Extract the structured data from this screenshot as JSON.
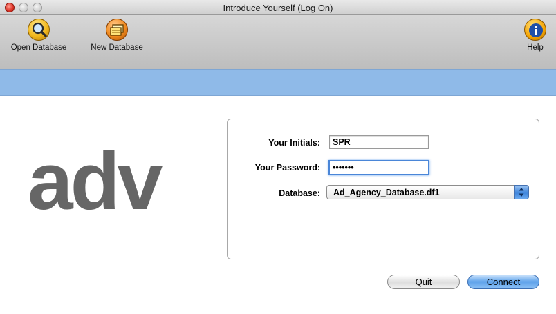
{
  "window": {
    "title": "Introduce Yourself (Log On)"
  },
  "toolbar": {
    "open_label": "Open Database",
    "new_label": "New Database",
    "help_label": "Help",
    "open_icon": "magnifier-icon",
    "new_icon": "new-database-icon",
    "help_icon": "info-icon"
  },
  "logo": {
    "text": "adv"
  },
  "form": {
    "initials_label": "Your Initials:",
    "initials_value": "SPR",
    "password_label": "Your Password:",
    "password_value": "•••••••",
    "database_label": "Database:",
    "database_value": "Ad_Agency_Database.df1"
  },
  "buttons": {
    "quit": "Quit",
    "connect": "Connect"
  },
  "colors": {
    "band": "#8fbae8",
    "logo": "#666666",
    "accent": "#5ea2ea"
  }
}
